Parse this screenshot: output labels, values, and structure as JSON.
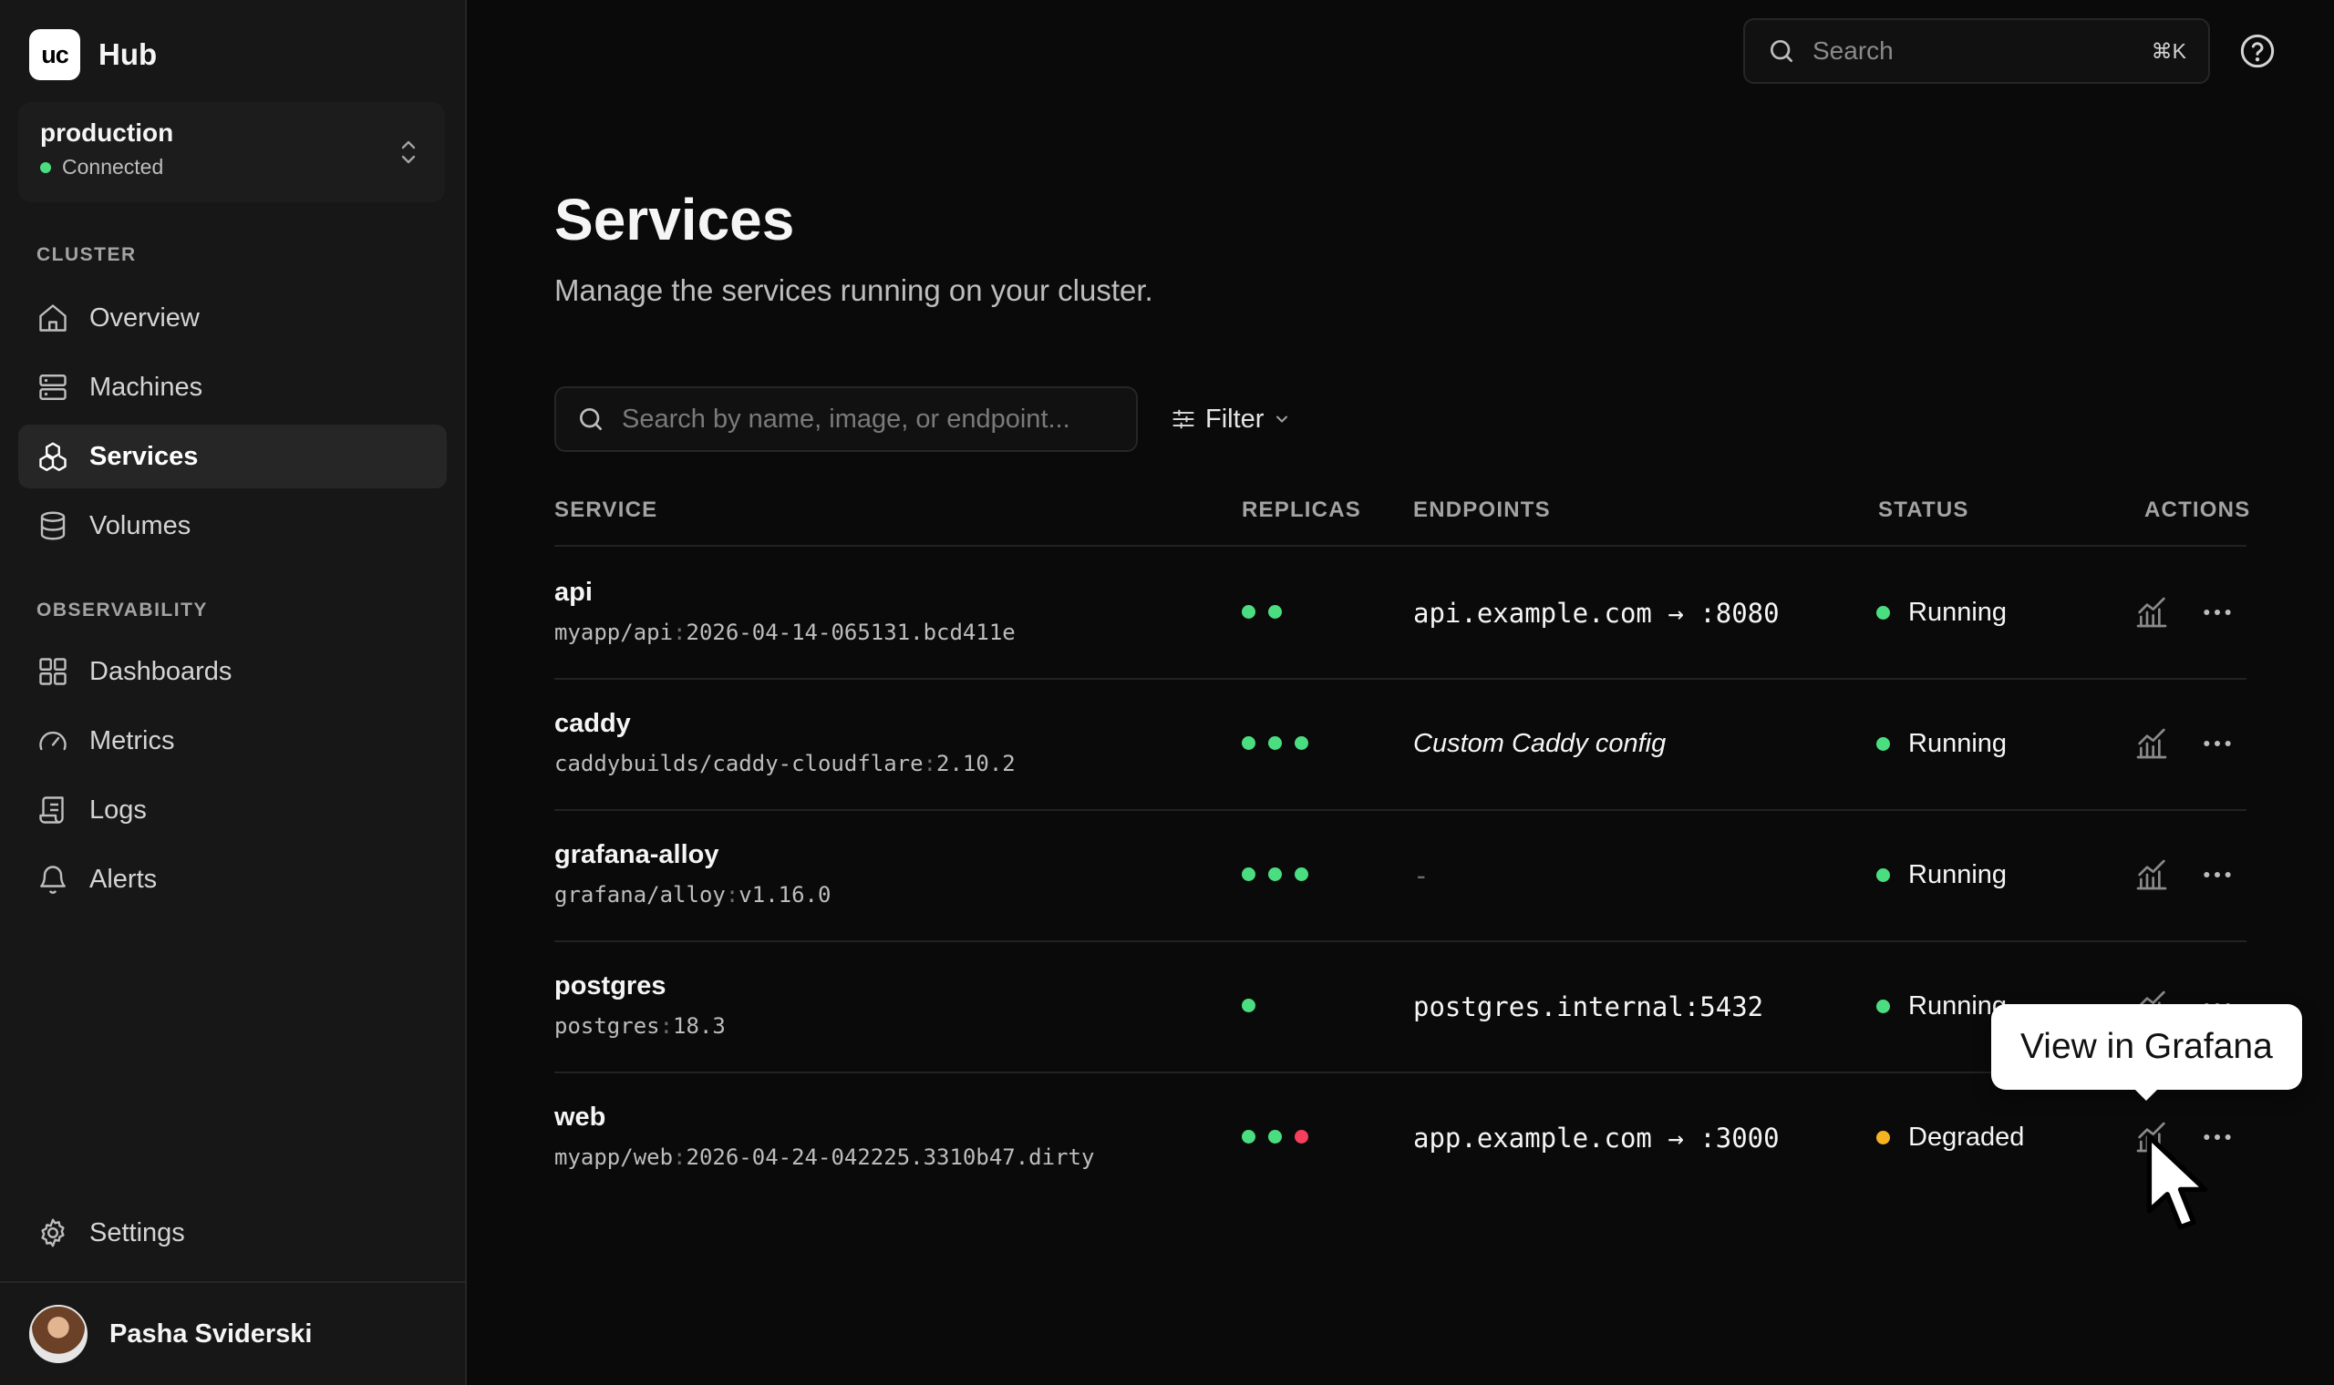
{
  "colors": {
    "green": "#4ade80",
    "red": "#f43f5e",
    "amber": "#f5b324",
    "bg": "#0a0a0a",
    "sidebar": "#171717"
  },
  "brand": {
    "logo_text": "uc",
    "name": "Hub"
  },
  "environment": {
    "name": "production",
    "status": "Connected"
  },
  "sidebar": {
    "cluster_label": "CLUSTER",
    "cluster_items": [
      {
        "label": "Overview",
        "icon": "home-icon"
      },
      {
        "label": "Machines",
        "icon": "server-icon"
      },
      {
        "label": "Services",
        "icon": "services-icon",
        "active": true
      },
      {
        "label": "Volumes",
        "icon": "database-icon"
      }
    ],
    "observability_label": "OBSERVABILITY",
    "observability_items": [
      {
        "label": "Dashboards",
        "icon": "grid-icon"
      },
      {
        "label": "Metrics",
        "icon": "gauge-icon"
      },
      {
        "label": "Logs",
        "icon": "scroll-icon"
      },
      {
        "label": "Alerts",
        "icon": "bell-icon"
      }
    ],
    "settings_label": "Settings"
  },
  "user": {
    "name": "Pasha Sviderski"
  },
  "search": {
    "placeholder": "Search",
    "shortcut": "⌘K"
  },
  "page": {
    "title": "Services",
    "subtitle": "Manage the services running on your cluster."
  },
  "table_search": {
    "placeholder": "Search by name, image, or endpoint..."
  },
  "filter_label": "Filter",
  "table": {
    "headers": [
      "SERVICE",
      "REPLICAS",
      "ENDPOINTS",
      "STATUS",
      "ACTIONS"
    ],
    "rows": [
      {
        "name": "api",
        "image_repo": "myapp/api",
        "image_tag": "2026-04-14-065131.bcd411e",
        "replicas": [
          "green",
          "green"
        ],
        "endpoint": "api.example.com → :8080",
        "endpoint_style": "mono",
        "status": "Running",
        "status_color": "green"
      },
      {
        "name": "caddy",
        "image_repo": "caddybuilds/caddy-cloudflare",
        "image_tag": "2.10.2",
        "replicas": [
          "green",
          "green",
          "green"
        ],
        "endpoint": "Custom Caddy config",
        "endpoint_style": "italic",
        "status": "Running",
        "status_color": "green"
      },
      {
        "name": "grafana-alloy",
        "image_repo": "grafana/alloy",
        "image_tag": "v1.16.0",
        "replicas": [
          "green",
          "green",
          "green"
        ],
        "endpoint": "-",
        "endpoint_style": "none",
        "status": "Running",
        "status_color": "green"
      },
      {
        "name": "postgres",
        "image_repo": "postgres",
        "image_tag": "18.3",
        "replicas": [
          "green"
        ],
        "endpoint": "postgres.internal:5432",
        "endpoint_style": "mono",
        "status": "Running",
        "status_color": "green"
      },
      {
        "name": "web",
        "image_repo": "myapp/web",
        "image_tag": "2026-04-24-042225.3310b47.dirty",
        "replicas": [
          "green",
          "green",
          "red"
        ],
        "endpoint": "app.example.com → :3000",
        "endpoint_style": "mono",
        "status": "Degraded",
        "status_color": "amber"
      }
    ]
  },
  "tooltip": {
    "text": "View in Grafana"
  }
}
